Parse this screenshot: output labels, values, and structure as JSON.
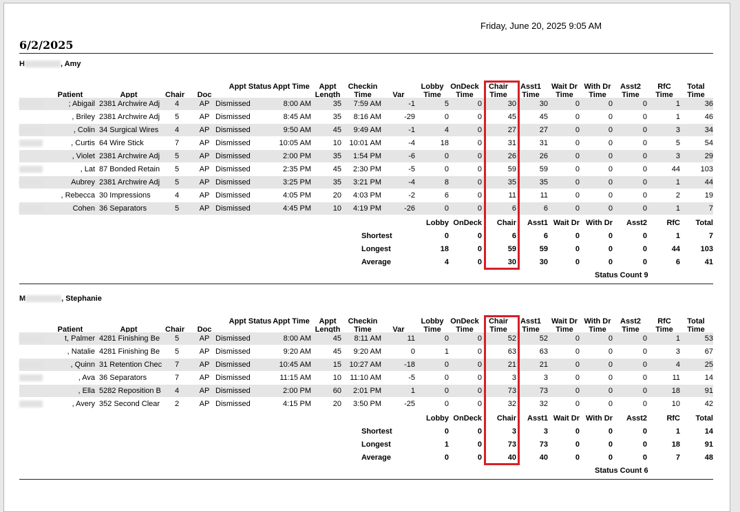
{
  "print_date": "Friday, June 20, 2025 9:05 AM",
  "report_date": "6/2/2025",
  "columns": [
    "Patient",
    "Appt",
    "Chair",
    "Doc",
    "Appt Status",
    "Appt Time",
    "Appt Length",
    "Checkin Time",
    "Var",
    "Lobby Time",
    "OnDeck Time",
    "Chair Time",
    "Asst1 Time",
    "Wait Dr Time",
    "With Dr Time",
    "Asst2 Time",
    "RfC Time",
    "Total Time"
  ],
  "summary_labels": {
    "lobby": "Lobby",
    "ondeck": "OnDeck",
    "chair": "Chair",
    "asst1": "Asst1",
    "waitdr": "Wait Dr",
    "withdr": "With Dr",
    "asst2": "Asst2",
    "rfc": "RfC",
    "total": "Total",
    "shortest": "Shortest",
    "longest": "Longest",
    "average": "Average",
    "status_count": "Status Count"
  },
  "groups": [
    {
      "provider_initial": "H",
      "provider_rest": ", Amy",
      "rows": [
        [
          "; Abigail",
          "2381 Archwire Adj",
          "4",
          "AP",
          "Dismissed",
          "8:00 AM",
          "35",
          "7:59 AM",
          "-1",
          "5",
          "0",
          "30",
          "30",
          "0",
          "0",
          "0",
          "1",
          "36"
        ],
        [
          ", Briley",
          "2381 Archwire Adj",
          "5",
          "AP",
          "Dismissed",
          "8:45 AM",
          "35",
          "8:16 AM",
          "-29",
          "0",
          "0",
          "45",
          "45",
          "0",
          "0",
          "0",
          "1",
          "46"
        ],
        [
          ", Colin",
          "34 Surgical Wires",
          "4",
          "AP",
          "Dismissed",
          "9:50 AM",
          "45",
          "9:49 AM",
          "-1",
          "4",
          "0",
          "27",
          "27",
          "0",
          "0",
          "0",
          "3",
          "34"
        ],
        [
          ", Curtis",
          "64 Wire Stick",
          "7",
          "AP",
          "Dismissed",
          "10:05 AM",
          "10",
          "10:01 AM",
          "-4",
          "18",
          "0",
          "31",
          "31",
          "0",
          "0",
          "0",
          "5",
          "54"
        ],
        [
          ", Violet",
          "2381 Archwire Adj",
          "5",
          "AP",
          "Dismissed",
          "2:00 PM",
          "35",
          "1:54 PM",
          "-6",
          "0",
          "0",
          "26",
          "26",
          "0",
          "0",
          "0",
          "3",
          "29"
        ],
        [
          ", Lat",
          "87 Bonded Retain",
          "5",
          "AP",
          "Dismissed",
          "2:35 PM",
          "45",
          "2:30 PM",
          "-5",
          "0",
          "0",
          "59",
          "59",
          "0",
          "0",
          "0",
          "44",
          "103"
        ],
        [
          "Aubrey",
          "2381 Archwire Adj",
          "5",
          "AP",
          "Dismissed",
          "3:25 PM",
          "35",
          "3:21 PM",
          "-4",
          "8",
          "0",
          "35",
          "35",
          "0",
          "0",
          "0",
          "1",
          "44"
        ],
        [
          ", Rebecca",
          "30 Impressions",
          "4",
          "AP",
          "Dismissed",
          "4:05 PM",
          "20",
          "4:03 PM",
          "-2",
          "6",
          "0",
          "11",
          "11",
          "0",
          "0",
          "0",
          "2",
          "19"
        ],
        [
          "Cohen",
          "36 Separators",
          "5",
          "AP",
          "Dismissed",
          "4:45 PM",
          "10",
          "4:19 PM",
          "-26",
          "0",
          "0",
          "6",
          "6",
          "0",
          "0",
          "0",
          "1",
          "7"
        ]
      ],
      "shortest": [
        "0",
        "0",
        "6",
        "6",
        "0",
        "0",
        "0",
        "1",
        "7"
      ],
      "longest": [
        "18",
        "0",
        "59",
        "59",
        "0",
        "0",
        "0",
        "44",
        "103"
      ],
      "average": [
        "4",
        "0",
        "30",
        "30",
        "0",
        "0",
        "0",
        "6",
        "41"
      ],
      "status_count": "9"
    },
    {
      "provider_initial": "M",
      "provider_rest": ", Stephanie",
      "rows": [
        [
          "t, Palmer",
          "4281 Finishing Be",
          "5",
          "AP",
          "Dismissed",
          "8:00 AM",
          "45",
          "8:11 AM",
          "11",
          "0",
          "0",
          "52",
          "52",
          "0",
          "0",
          "0",
          "1",
          "53"
        ],
        [
          ", Natalie",
          "4281 Finishing Be",
          "5",
          "AP",
          "Dismissed",
          "9:20 AM",
          "45",
          "9:20 AM",
          "0",
          "1",
          "0",
          "63",
          "63",
          "0",
          "0",
          "0",
          "3",
          "67"
        ],
        [
          ", Quinn",
          "31 Retention Chec",
          "7",
          "AP",
          "Dismissed",
          "10:45 AM",
          "15",
          "10:27 AM",
          "-18",
          "0",
          "0",
          "21",
          "21",
          "0",
          "0",
          "0",
          "4",
          "25"
        ],
        [
          ", Ava",
          "36 Separators",
          "7",
          "AP",
          "Dismissed",
          "11:15 AM",
          "10",
          "11:10 AM",
          "-5",
          "0",
          "0",
          "3",
          "3",
          "0",
          "0",
          "0",
          "11",
          "14"
        ],
        [
          ", Ella",
          "5282 Reposition B",
          "4",
          "AP",
          "Dismissed",
          "2:00 PM",
          "60",
          "2:01 PM",
          "1",
          "0",
          "0",
          "73",
          "73",
          "0",
          "0",
          "0",
          "18",
          "91"
        ],
        [
          ", Avery",
          "352 Second Clear",
          "2",
          "AP",
          "Dismissed",
          "4:15 PM",
          "20",
          "3:50 PM",
          "-25",
          "0",
          "0",
          "32",
          "32",
          "0",
          "0",
          "0",
          "10",
          "42"
        ]
      ],
      "shortest": [
        "0",
        "0",
        "3",
        "3",
        "0",
        "0",
        "0",
        "1",
        "14"
      ],
      "longest": [
        "1",
        "0",
        "73",
        "73",
        "0",
        "0",
        "0",
        "18",
        "91"
      ],
      "average": [
        "0",
        "0",
        "40",
        "40",
        "0",
        "0",
        "0",
        "7",
        "48"
      ],
      "status_count": "6"
    }
  ]
}
